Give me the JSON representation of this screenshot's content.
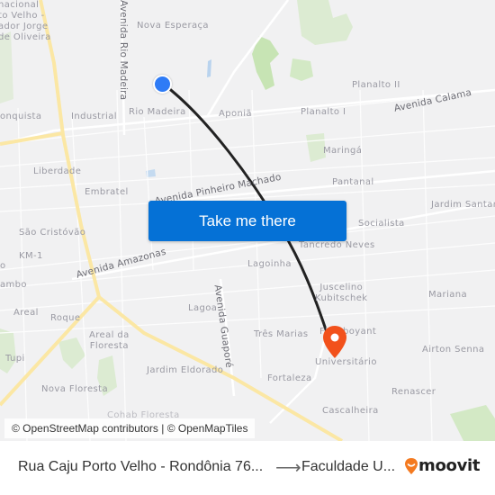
{
  "map": {
    "labels": {
      "airport": "nacional\nto Velho -\nador Jorge\nde Oliveira",
      "nova_esperanca": "Nova Esperaça",
      "avenida_rio_madeira": "Avenida Rio Madeira",
      "conquista": "onquista",
      "industrial": "Industrial",
      "rio_madeira": "Rio Madeira",
      "aponia": "Aponiã",
      "planalto_ii": "Planalto II",
      "planalto_i": "Planalto I",
      "avenida_calama": "Avenida Calama",
      "maringa": "Maringá",
      "liberdade": "Liberdade",
      "embratel": "Embratel",
      "avenida_pinheiro_machado": "Avenida Pinheiro Machado",
      "pantanal": "Pantanal",
      "jardim_santana": "Jardim Santan",
      "sao_cristovao": "São Cristóvão",
      "socialista": "Socialista",
      "tancredo_neves": "Tancredo Neves",
      "km1": "KM-1",
      "avenida_amazonas": "Avenida Amazonas",
      "o_edge": "o",
      "lagoinha": "Lagoinha",
      "cambo": "ambo",
      "juscelino_kubitschek": "Juscelino\nKubitschek",
      "mariana": "Mariana",
      "areal": "Areal",
      "roque": "Roque",
      "lagoa": "Lagoa",
      "avenida_guapore": "Avenida Guaporé",
      "areal_da_floresta": "Areal da\nFloresta",
      "tres_marias": "Três Marias",
      "flamboyant": "Flamboyant",
      "tupi": "Tupi",
      "universitario": "Universitário",
      "airton_senna": "Airton Senna",
      "jardim_eldorado": "Jardim Eldorado",
      "fortaleza": "Fortaleza",
      "nova_floresta": "Nova Floresta",
      "renascer": "Renascer",
      "cascalheira": "Cascalheira",
      "cohab_floresta": "Cohab Floresta"
    },
    "cta_label": "Take me there",
    "attribution": "© OpenStreetMap contributors | © OpenMapTiles",
    "colors": {
      "cta": "#0571d6",
      "origin": "#2e7bf6",
      "destination": "#f2511b",
      "route": "#222222",
      "major_road": "#fbe7a4",
      "park": "#cfe8c0",
      "water": "#b9d3ee"
    }
  },
  "footer": {
    "origin": "Rua Caju Porto Velho - Rondônia 76...",
    "arrow": "⟶",
    "destination": "Faculdade U...",
    "brand": "moovit"
  }
}
